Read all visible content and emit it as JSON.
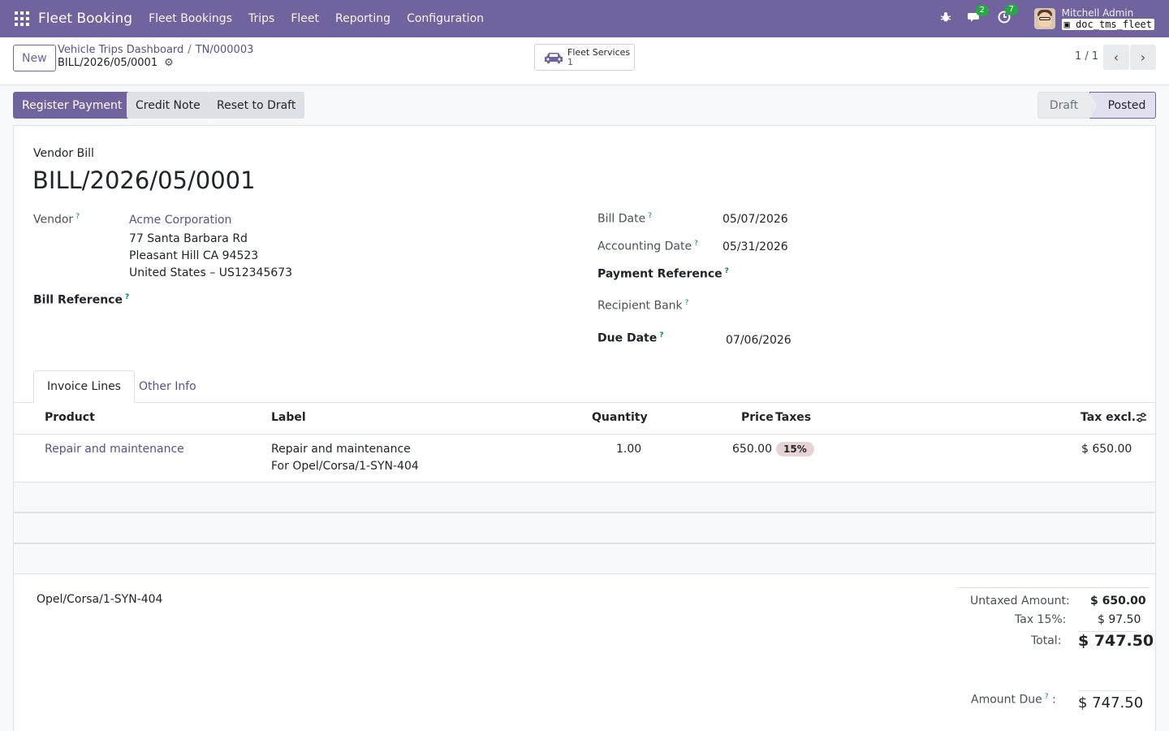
{
  "navbar": {
    "app_name": "Fleet Booking",
    "menu": [
      "Fleet Bookings",
      "Trips",
      "Fleet",
      "Reporting",
      "Configuration"
    ],
    "messages_count": "2",
    "activities_count": "7",
    "user_name": "Mitchell Admin",
    "database": "doc_tms_fleet"
  },
  "control": {
    "new_label": "New",
    "breadcrumb": [
      "Vehicle Trips Dashboard",
      "TN/000003"
    ],
    "record_name": "BILL/2026/05/0001",
    "smart_button": {
      "label": "Fleet Services",
      "count": "1"
    },
    "pager": "1 / 1"
  },
  "actions": {
    "register_payment": "Register Payment",
    "credit_note": "Credit Note",
    "reset_to_draft": "Reset to Draft"
  },
  "statusbar": {
    "draft": "Draft",
    "posted": "Posted",
    "current": "Posted"
  },
  "bill": {
    "type": "Vendor Bill",
    "number": "BILL/2026/05/0001",
    "vendor_label": "Vendor",
    "vendor_name": "Acme Corporation",
    "vendor_address": [
      "77 Santa Barbara Rd",
      "Pleasant Hill CA 94523",
      "United States – US12345673"
    ],
    "bill_reference_label": "Bill Reference",
    "bill_date_label": "Bill Date",
    "bill_date": "05/07/2026",
    "accounting_date_label": "Accounting Date",
    "accounting_date": "05/31/2026",
    "payment_reference_label": "Payment Reference",
    "recipient_bank_label": "Recipient Bank",
    "due_date_label": "Due Date",
    "due_date": "07/06/2026"
  },
  "tabs": [
    "Invoice Lines",
    "Other Info"
  ],
  "lines": {
    "headers": [
      "Product",
      "Label",
      "Quantity",
      "Price",
      "Taxes",
      "Tax excl."
    ],
    "rows": [
      {
        "product": "Repair and maintenance",
        "label_line1": "Repair and maintenance",
        "label_line2": "For Opel/Corsa/1-SYN-404",
        "quantity": "1.00",
        "price": "650.00",
        "tax": "15%",
        "subtotal": "$ 650.00"
      }
    ]
  },
  "narration": "Opel/Corsa/1-SYN-404",
  "totals": {
    "untaxed_label": "Untaxed Amount:",
    "untaxed": "$ 650.00",
    "tax_label": "Tax 15%:",
    "tax": "$ 97.50",
    "total_label": "Total:",
    "total": "$ 747.50",
    "amount_due_label": "Amount Due",
    "amount_due": "$ 747.50"
  },
  "colors": {
    "brand": "#71639e",
    "link": "#5d4f8c",
    "badge": "#28a745"
  }
}
